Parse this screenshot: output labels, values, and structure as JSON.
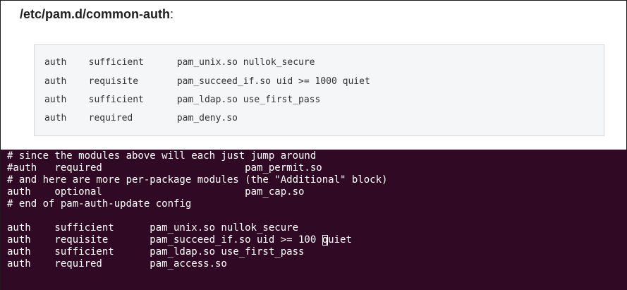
{
  "doc": {
    "heading_path": "/etc/pam.d/common-auth",
    "heading_suffix": ":",
    "code_lines": [
      "auth    sufficient      pam_unix.so nullok_secure",
      "auth    requisite       pam_succeed_if.so uid >= 1000 quiet",
      "auth    sufficient      pam_ldap.so use_first_pass",
      "auth    required        pam_deny.so"
    ]
  },
  "terminal": {
    "background_color": "#300a24",
    "text_color": "#ffffff",
    "lines": [
      "# since the modules above will each just jump around",
      "#auth   required                        pam_permit.so",
      "# and here are more per-package modules (the \"Additional\" block)",
      "auth    optional                        pam_cap.so",
      "# end of pam-auth-update config",
      "",
      "auth    sufficient      pam_unix.so nullok_secure",
      "auth    requisite       pam_succeed_if.so uid >= 100 quiet",
      "auth    sufficient      pam_ldap.so use_first_pass",
      "auth    required        pam_access.so"
    ],
    "cursor_line": {
      "before": "auth    requisite       pam_succeed_if.so uid >= 100 ",
      "cursor_char": "q",
      "after": "uiet"
    }
  }
}
